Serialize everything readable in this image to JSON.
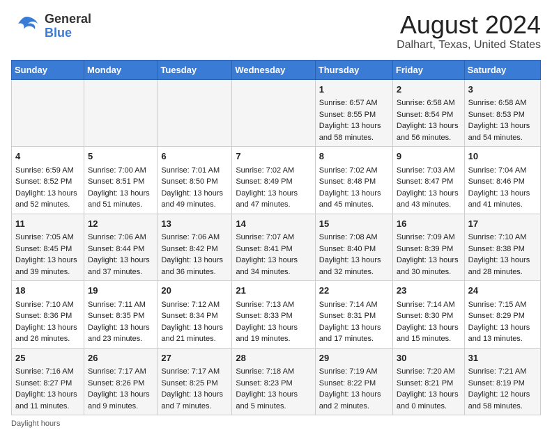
{
  "logo": {
    "general": "General",
    "blue": "Blue"
  },
  "title": "August 2024",
  "location": "Dalhart, Texas, United States",
  "days_of_week": [
    "Sunday",
    "Monday",
    "Tuesday",
    "Wednesday",
    "Thursday",
    "Friday",
    "Saturday"
  ],
  "footer": "Daylight hours",
  "weeks": [
    [
      {
        "day": "",
        "content": ""
      },
      {
        "day": "",
        "content": ""
      },
      {
        "day": "",
        "content": ""
      },
      {
        "day": "",
        "content": ""
      },
      {
        "day": "1",
        "content": "Sunrise: 6:57 AM\nSunset: 8:55 PM\nDaylight: 13 hours and 58 minutes."
      },
      {
        "day": "2",
        "content": "Sunrise: 6:58 AM\nSunset: 8:54 PM\nDaylight: 13 hours and 56 minutes."
      },
      {
        "day": "3",
        "content": "Sunrise: 6:58 AM\nSunset: 8:53 PM\nDaylight: 13 hours and 54 minutes."
      }
    ],
    [
      {
        "day": "4",
        "content": "Sunrise: 6:59 AM\nSunset: 8:52 PM\nDaylight: 13 hours and 52 minutes."
      },
      {
        "day": "5",
        "content": "Sunrise: 7:00 AM\nSunset: 8:51 PM\nDaylight: 13 hours and 51 minutes."
      },
      {
        "day": "6",
        "content": "Sunrise: 7:01 AM\nSunset: 8:50 PM\nDaylight: 13 hours and 49 minutes."
      },
      {
        "day": "7",
        "content": "Sunrise: 7:02 AM\nSunset: 8:49 PM\nDaylight: 13 hours and 47 minutes."
      },
      {
        "day": "8",
        "content": "Sunrise: 7:02 AM\nSunset: 8:48 PM\nDaylight: 13 hours and 45 minutes."
      },
      {
        "day": "9",
        "content": "Sunrise: 7:03 AM\nSunset: 8:47 PM\nDaylight: 13 hours and 43 minutes."
      },
      {
        "day": "10",
        "content": "Sunrise: 7:04 AM\nSunset: 8:46 PM\nDaylight: 13 hours and 41 minutes."
      }
    ],
    [
      {
        "day": "11",
        "content": "Sunrise: 7:05 AM\nSunset: 8:45 PM\nDaylight: 13 hours and 39 minutes."
      },
      {
        "day": "12",
        "content": "Sunrise: 7:06 AM\nSunset: 8:44 PM\nDaylight: 13 hours and 37 minutes."
      },
      {
        "day": "13",
        "content": "Sunrise: 7:06 AM\nSunset: 8:42 PM\nDaylight: 13 hours and 36 minutes."
      },
      {
        "day": "14",
        "content": "Sunrise: 7:07 AM\nSunset: 8:41 PM\nDaylight: 13 hours and 34 minutes."
      },
      {
        "day": "15",
        "content": "Sunrise: 7:08 AM\nSunset: 8:40 PM\nDaylight: 13 hours and 32 minutes."
      },
      {
        "day": "16",
        "content": "Sunrise: 7:09 AM\nSunset: 8:39 PM\nDaylight: 13 hours and 30 minutes."
      },
      {
        "day": "17",
        "content": "Sunrise: 7:10 AM\nSunset: 8:38 PM\nDaylight: 13 hours and 28 minutes."
      }
    ],
    [
      {
        "day": "18",
        "content": "Sunrise: 7:10 AM\nSunset: 8:36 PM\nDaylight: 13 hours and 26 minutes."
      },
      {
        "day": "19",
        "content": "Sunrise: 7:11 AM\nSunset: 8:35 PM\nDaylight: 13 hours and 23 minutes."
      },
      {
        "day": "20",
        "content": "Sunrise: 7:12 AM\nSunset: 8:34 PM\nDaylight: 13 hours and 21 minutes."
      },
      {
        "day": "21",
        "content": "Sunrise: 7:13 AM\nSunset: 8:33 PM\nDaylight: 13 hours and 19 minutes."
      },
      {
        "day": "22",
        "content": "Sunrise: 7:14 AM\nSunset: 8:31 PM\nDaylight: 13 hours and 17 minutes."
      },
      {
        "day": "23",
        "content": "Sunrise: 7:14 AM\nSunset: 8:30 PM\nDaylight: 13 hours and 15 minutes."
      },
      {
        "day": "24",
        "content": "Sunrise: 7:15 AM\nSunset: 8:29 PM\nDaylight: 13 hours and 13 minutes."
      }
    ],
    [
      {
        "day": "25",
        "content": "Sunrise: 7:16 AM\nSunset: 8:27 PM\nDaylight: 13 hours and 11 minutes."
      },
      {
        "day": "26",
        "content": "Sunrise: 7:17 AM\nSunset: 8:26 PM\nDaylight: 13 hours and 9 minutes."
      },
      {
        "day": "27",
        "content": "Sunrise: 7:17 AM\nSunset: 8:25 PM\nDaylight: 13 hours and 7 minutes."
      },
      {
        "day": "28",
        "content": "Sunrise: 7:18 AM\nSunset: 8:23 PM\nDaylight: 13 hours and 5 minutes."
      },
      {
        "day": "29",
        "content": "Sunrise: 7:19 AM\nSunset: 8:22 PM\nDaylight: 13 hours and 2 minutes."
      },
      {
        "day": "30",
        "content": "Sunrise: 7:20 AM\nSunset: 8:21 PM\nDaylight: 13 hours and 0 minutes."
      },
      {
        "day": "31",
        "content": "Sunrise: 7:21 AM\nSunset: 8:19 PM\nDaylight: 12 hours and 58 minutes."
      }
    ]
  ]
}
